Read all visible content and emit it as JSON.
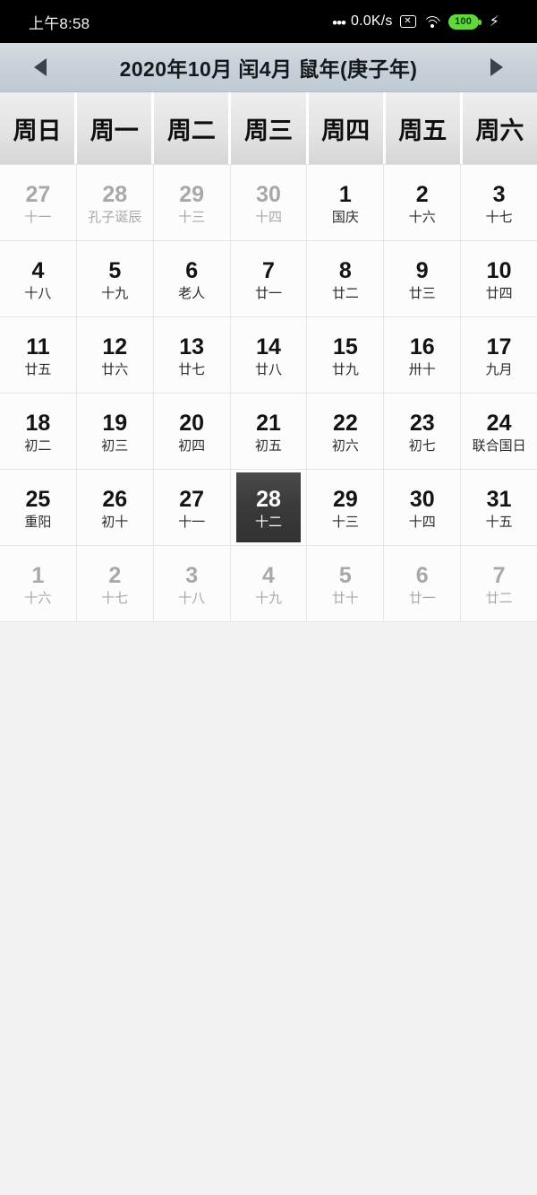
{
  "statusbar": {
    "time": "上午8:58",
    "network_dots": "•••",
    "network_speed": "0.0K/s",
    "nosim_glyph": "✕",
    "battery_level": "100",
    "charging_glyph": "⚡",
    "battery_color": "#5fd83c"
  },
  "header": {
    "prev_label": "◀",
    "next_label": "▶",
    "title": "2020年10月 闰4月 鼠年(庚子年)",
    "bar_color": "#c7d1d9"
  },
  "weekdays": [
    "周日",
    "周一",
    "周二",
    "周三",
    "周四",
    "周五",
    "周六"
  ],
  "selected": {
    "day": "28",
    "lunar": "十二",
    "bg_color": "#3b3b3b"
  },
  "weeks": [
    [
      {
        "num": "27",
        "sub": "十一",
        "muted": true,
        "selected": false
      },
      {
        "num": "28",
        "sub": "孔子诞辰",
        "muted": true,
        "selected": false
      },
      {
        "num": "29",
        "sub": "十三",
        "muted": true,
        "selected": false
      },
      {
        "num": "30",
        "sub": "十四",
        "muted": true,
        "selected": false
      },
      {
        "num": "1",
        "sub": "国庆",
        "muted": false,
        "selected": false
      },
      {
        "num": "2",
        "sub": "十六",
        "muted": false,
        "selected": false
      },
      {
        "num": "3",
        "sub": "十七",
        "muted": false,
        "selected": false
      }
    ],
    [
      {
        "num": "4",
        "sub": "十八",
        "muted": false,
        "selected": false
      },
      {
        "num": "5",
        "sub": "十九",
        "muted": false,
        "selected": false
      },
      {
        "num": "6",
        "sub": "老人",
        "muted": false,
        "selected": false
      },
      {
        "num": "7",
        "sub": "廿一",
        "muted": false,
        "selected": false
      },
      {
        "num": "8",
        "sub": "廿二",
        "muted": false,
        "selected": false
      },
      {
        "num": "9",
        "sub": "廿三",
        "muted": false,
        "selected": false
      },
      {
        "num": "10",
        "sub": "廿四",
        "muted": false,
        "selected": false
      }
    ],
    [
      {
        "num": "11",
        "sub": "廿五",
        "muted": false,
        "selected": false
      },
      {
        "num": "12",
        "sub": "廿六",
        "muted": false,
        "selected": false
      },
      {
        "num": "13",
        "sub": "廿七",
        "muted": false,
        "selected": false
      },
      {
        "num": "14",
        "sub": "廿八",
        "muted": false,
        "selected": false
      },
      {
        "num": "15",
        "sub": "廿九",
        "muted": false,
        "selected": false
      },
      {
        "num": "16",
        "sub": "卅十",
        "muted": false,
        "selected": false
      },
      {
        "num": "17",
        "sub": "九月",
        "muted": false,
        "selected": false
      }
    ],
    [
      {
        "num": "18",
        "sub": "初二",
        "muted": false,
        "selected": false
      },
      {
        "num": "19",
        "sub": "初三",
        "muted": false,
        "selected": false
      },
      {
        "num": "20",
        "sub": "初四",
        "muted": false,
        "selected": false
      },
      {
        "num": "21",
        "sub": "初五",
        "muted": false,
        "selected": false
      },
      {
        "num": "22",
        "sub": "初六",
        "muted": false,
        "selected": false
      },
      {
        "num": "23",
        "sub": "初七",
        "muted": false,
        "selected": false
      },
      {
        "num": "24",
        "sub": "联合国日",
        "muted": false,
        "selected": false
      }
    ],
    [
      {
        "num": "25",
        "sub": "重阳",
        "muted": false,
        "selected": false
      },
      {
        "num": "26",
        "sub": "初十",
        "muted": false,
        "selected": false
      },
      {
        "num": "27",
        "sub": "十一",
        "muted": false,
        "selected": false
      },
      {
        "num": "28",
        "sub": "十二",
        "muted": false,
        "selected": true
      },
      {
        "num": "29",
        "sub": "十三",
        "muted": false,
        "selected": false
      },
      {
        "num": "30",
        "sub": "十四",
        "muted": false,
        "selected": false
      },
      {
        "num": "31",
        "sub": "十五",
        "muted": false,
        "selected": false
      }
    ],
    [
      {
        "num": "1",
        "sub": "十六",
        "muted": true,
        "selected": false
      },
      {
        "num": "2",
        "sub": "十七",
        "muted": true,
        "selected": false
      },
      {
        "num": "3",
        "sub": "十八",
        "muted": true,
        "selected": false
      },
      {
        "num": "4",
        "sub": "十九",
        "muted": true,
        "selected": false
      },
      {
        "num": "5",
        "sub": "廿十",
        "muted": true,
        "selected": false
      },
      {
        "num": "6",
        "sub": "廿一",
        "muted": true,
        "selected": false
      },
      {
        "num": "7",
        "sub": "廿二",
        "muted": true,
        "selected": false
      }
    ]
  ]
}
